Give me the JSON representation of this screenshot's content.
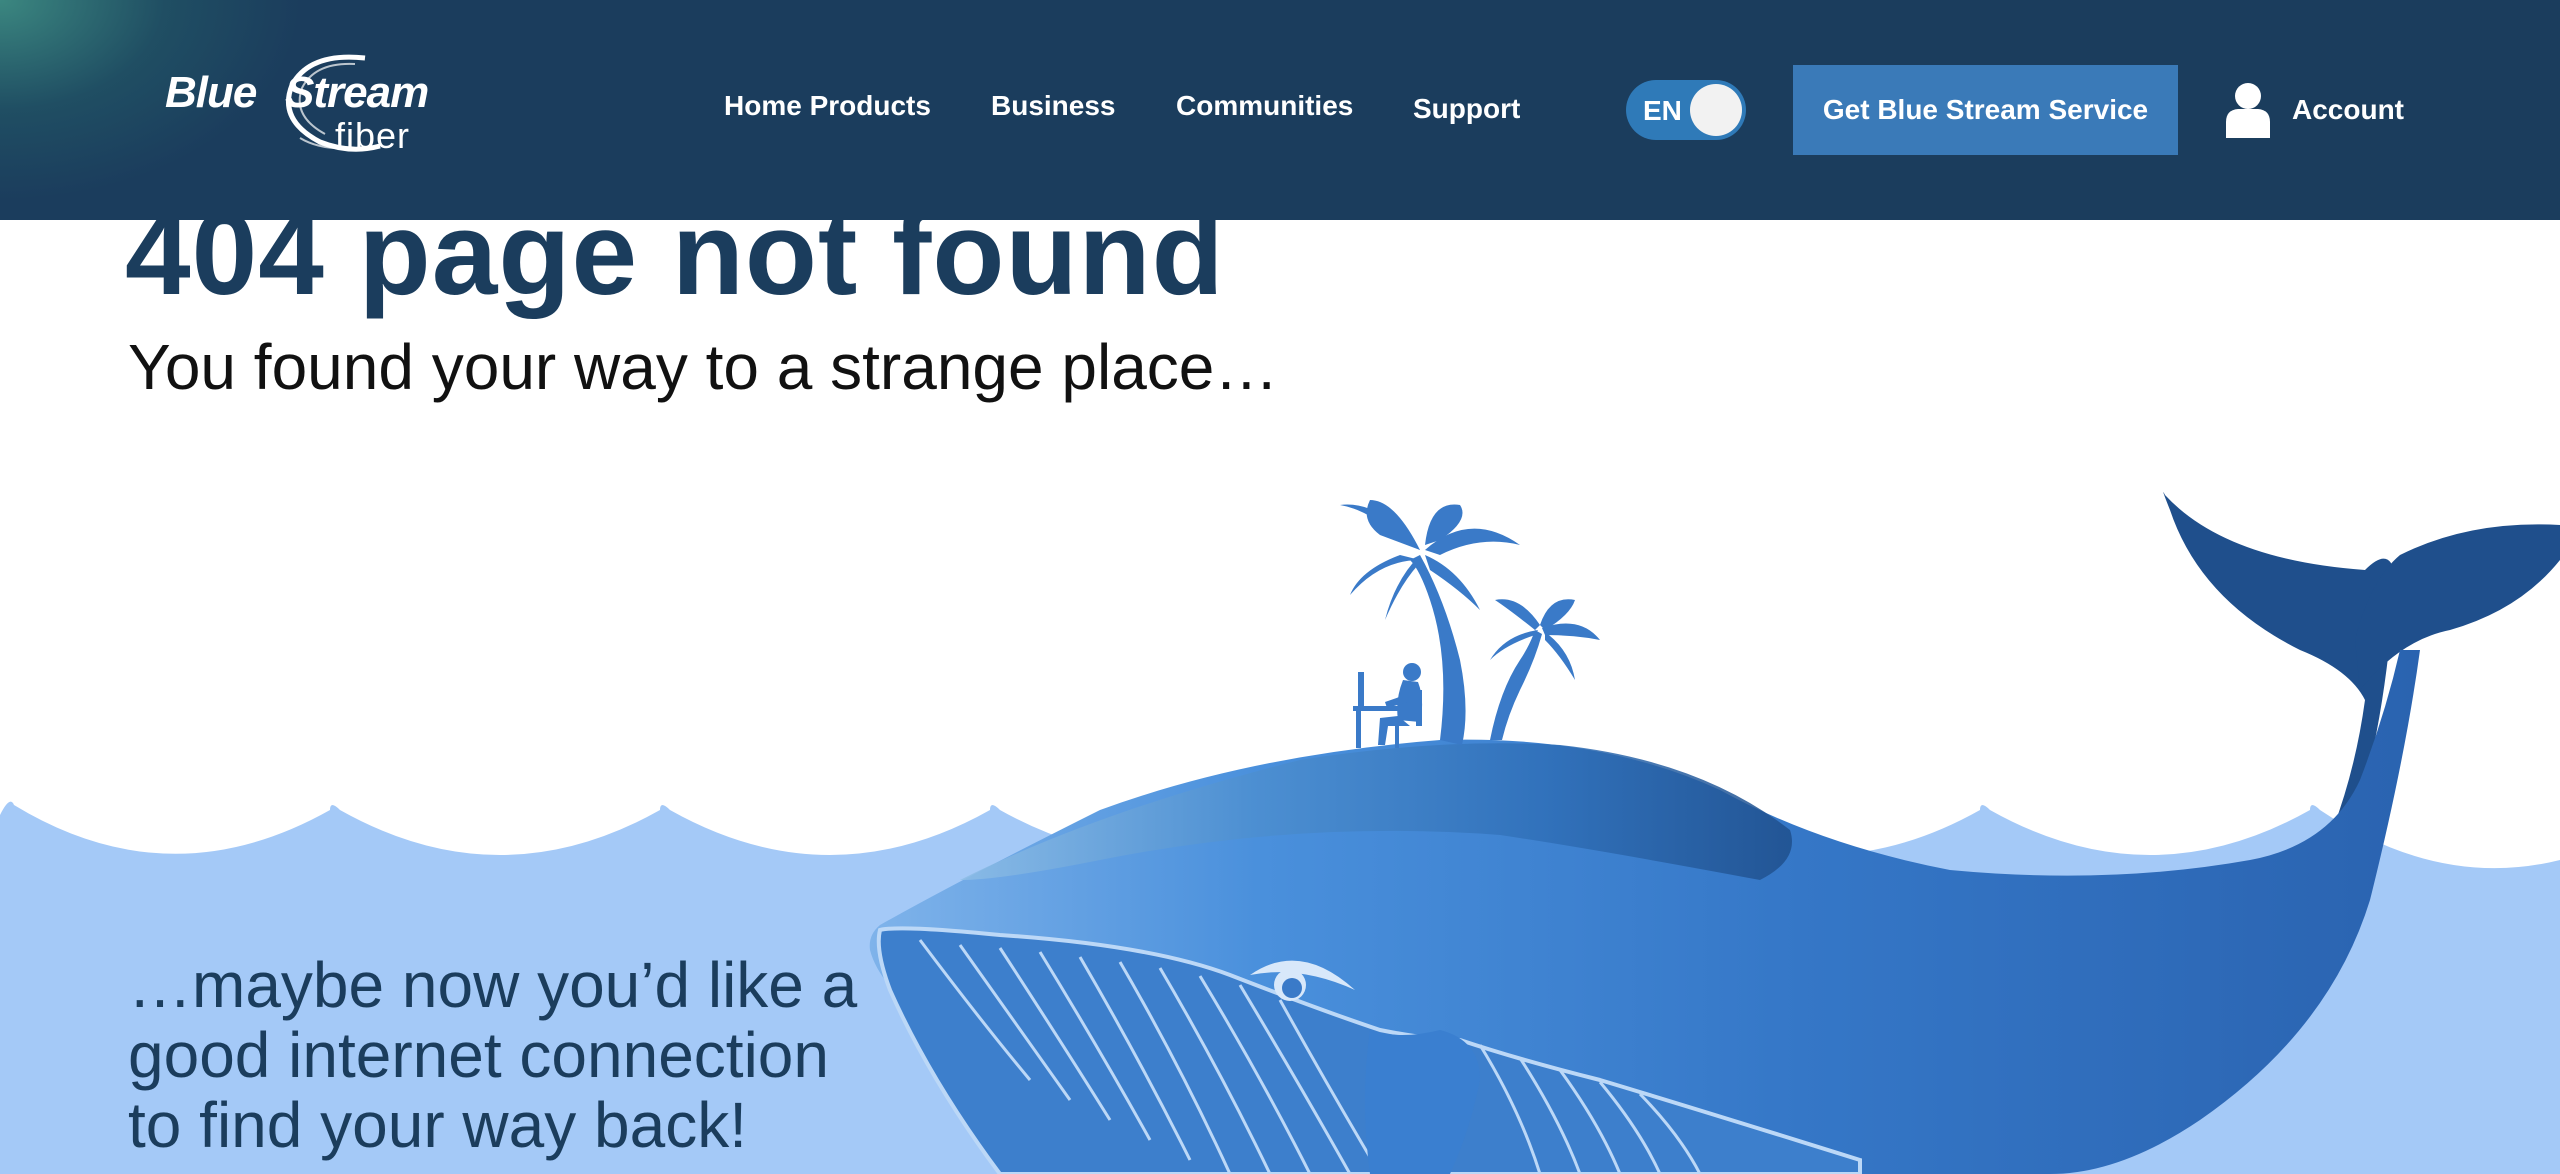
{
  "header": {
    "logo_text_primary": "Blue",
    "logo_text_secondary": "Stream",
    "logo_text_sub": "fiber",
    "nav": [
      {
        "label": "Home Products"
      },
      {
        "label": "Business"
      },
      {
        "label": "Communities"
      },
      {
        "label": "Support"
      }
    ],
    "language": "EN",
    "cta_label": "Get Blue Stream Service",
    "account_label": "Account"
  },
  "main": {
    "title": "404 page not found",
    "subtitle": "You found your way to a strange place…",
    "message_lines": [
      "…maybe now you’d like a",
      "good internet connection",
      "to find your way back!"
    ]
  },
  "icons": {
    "account": "user-icon",
    "logo_swirl": "swirl-icon"
  },
  "colors": {
    "header_bg": "#1b3d5d",
    "cta_bg": "#3a7ab8",
    "toggle_bg": "#2f7ab8",
    "title": "#1b3d5d",
    "sea": "#a4c9f7",
    "whale": "#3578c8",
    "whale_dark": "#1f4f8c"
  }
}
